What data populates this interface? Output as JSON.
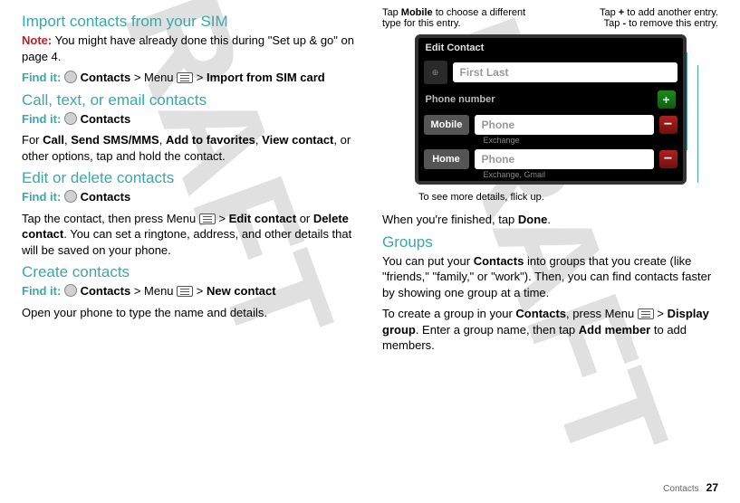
{
  "watermark": "DRAFT",
  "left": {
    "h1": "Import contacts from your SIM",
    "noteLabel": "Note:",
    "noteText": " You might have already done this during \"Set up & go\" on page 4.",
    "find1a": "Find it:",
    "find1b": "Contacts",
    "find1c": " > Menu ",
    "find1d": "Import from SIM card",
    "h2": "Call, text, or email contacts",
    "find2a": "Find it:",
    "find2b": "Contacts",
    "p2a": "For ",
    "p2b": "Call",
    "p2c": ", ",
    "p2d": "Send SMS/MMS",
    "p2e": ", ",
    "p2f": "Add to favorites",
    "p2g": ", ",
    "p2h": "View contact",
    "p2i": ", or other options, tap and hold the contact.",
    "h3": "Edit or delete contacts",
    "find3a": "Find it:",
    "find3b": "Contacts",
    "p3a": "Tap the contact, then press Menu ",
    "p3b": "Edit contact",
    "p3c": " or ",
    "p3d": "Delete contact",
    "p3e": ". You can set a ringtone, address, and other details that will be saved on your phone.",
    "h4": "Create contacts",
    "find4a": "Find it:",
    "find4b": "Contacts",
    "find4c": " > Menu ",
    "find4d": "New contact",
    "p4": "Open your phone to type the name and details."
  },
  "right": {
    "calloutLeft1": "Tap ",
    "calloutLeft2": "Mobile",
    "calloutLeft3": " to choose a different type for this entry.",
    "calloutR1a": "Tap ",
    "calloutR1b": "+",
    "calloutR1c": " to add another entry.",
    "calloutR2a": "Tap ",
    "calloutR2b": "-",
    "calloutR2c": " to remove this entry.",
    "caption": "To see more details, flick up.",
    "p1a": "When you're finished, tap ",
    "p1b": "Done",
    "p1c": ".",
    "h5": "Groups",
    "p2a": "You can put your ",
    "p2b": "Contacts",
    "p2c": " into groups that you create (like \"friends,\" \"family,\" or \"work\"). Then, you can find contacts faster by showing one group at a time.",
    "p3a": "To create a group in your ",
    "p3b": "Contacts",
    "p3c": ", press Menu ",
    "p3d": "Display group",
    "p3e": ". Enter a group name, then tap ",
    "p3f": "Add member",
    "p3g": " to add members."
  },
  "phone": {
    "title": "Edit Contact",
    "namePlaceholder": "First Last",
    "sectionPhone": "Phone number",
    "typeMobile": "Mobile",
    "typeHome": "Home",
    "phonePlaceholder": "Phone",
    "sub1": "Exchange",
    "sub2": "Exchange, Gmail",
    "plus": "+",
    "minus": "−"
  },
  "footer": {
    "label": "Contacts",
    "page": "27"
  }
}
